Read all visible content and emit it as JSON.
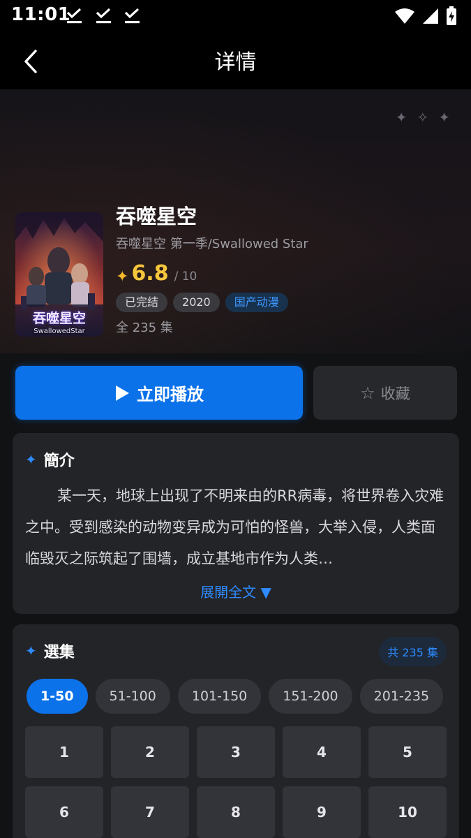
{
  "status_bar": {
    "time": "11:01"
  },
  "header": {
    "title": "详情"
  },
  "show": {
    "title": "吞噬星空",
    "alt_title": "吞噬星空 第一季/Swallowed Star",
    "rating": "6.8",
    "rating_max": "/ 10",
    "tags": [
      "已完結",
      "2020",
      "国产动漫"
    ],
    "episode_count": "全 235 集",
    "poster_title": "吞噬星空",
    "poster_subtitle": "SwallowedStar"
  },
  "actions": {
    "play_label": "立即播放",
    "favorite_label": "收藏"
  },
  "synopsis": {
    "title": "簡介",
    "text": "某一天，地球上出现了不明来由的RR病毒，将世界卷入灾难之中。受到感染的动物变异成为可怕的怪兽，大举入侵，人类面临毁灭之际筑起了围墙，成立基地市作为人类…",
    "expand_label": "展開全文 ▼"
  },
  "episodes": {
    "title": "選集",
    "total_label": "共 235 集",
    "ranges": [
      "1-50",
      "51-100",
      "101-150",
      "151-200",
      "201-235"
    ],
    "active_range": "1-50",
    "items": [
      "1",
      "2",
      "3",
      "4",
      "5",
      "6",
      "7",
      "8",
      "9",
      "10"
    ]
  },
  "colors": {
    "accent": "#0b72ea",
    "rating": "#f6c63c",
    "card_bg": "#232428",
    "page_bg": "#111214"
  }
}
